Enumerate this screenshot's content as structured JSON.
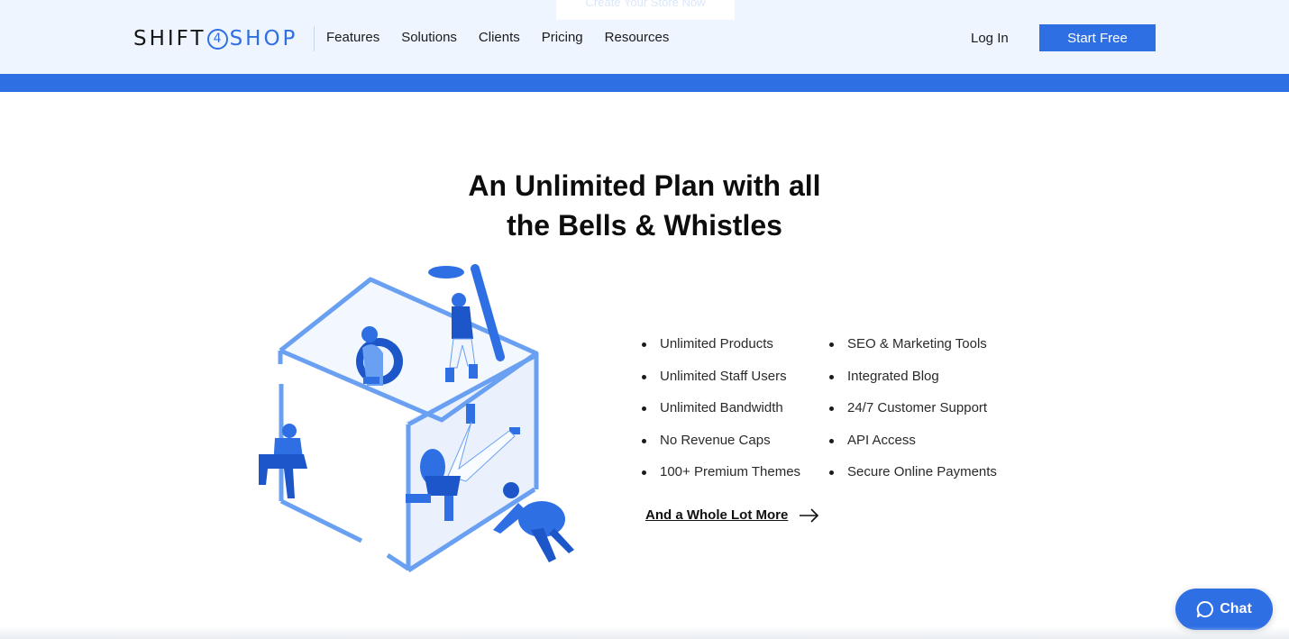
{
  "header": {
    "ghost_button": "Create Your Store Now",
    "logo": {
      "left": "SHIFT",
      "number": "4",
      "right": "SHOP"
    },
    "nav": [
      "Features",
      "Solutions",
      "Clients",
      "Pricing",
      "Resources"
    ],
    "login": "Log In",
    "cta": "Start Free"
  },
  "hero": {
    "title_line1": "An Unlimited Plan with all",
    "title_line2": "the Bells & Whistles"
  },
  "features": {
    "col1": [
      "Unlimited Products",
      "Unlimited Staff Users",
      "Unlimited Bandwidth",
      "No Revenue Caps",
      "100+ Premium Themes"
    ],
    "col2": [
      "SEO & Marketing Tools",
      "Integrated Blog",
      "24/7 Customer Support",
      "API Access",
      "Secure Online Payments"
    ]
  },
  "more_link": "And a Whole Lot More",
  "chat": {
    "label": "Chat",
    "icon": "chat-bubble-icon"
  },
  "colors": {
    "accent": "#2f6fe4",
    "topbar_bg": "#eef5fe",
    "light_blue": "#6aa0f2"
  }
}
